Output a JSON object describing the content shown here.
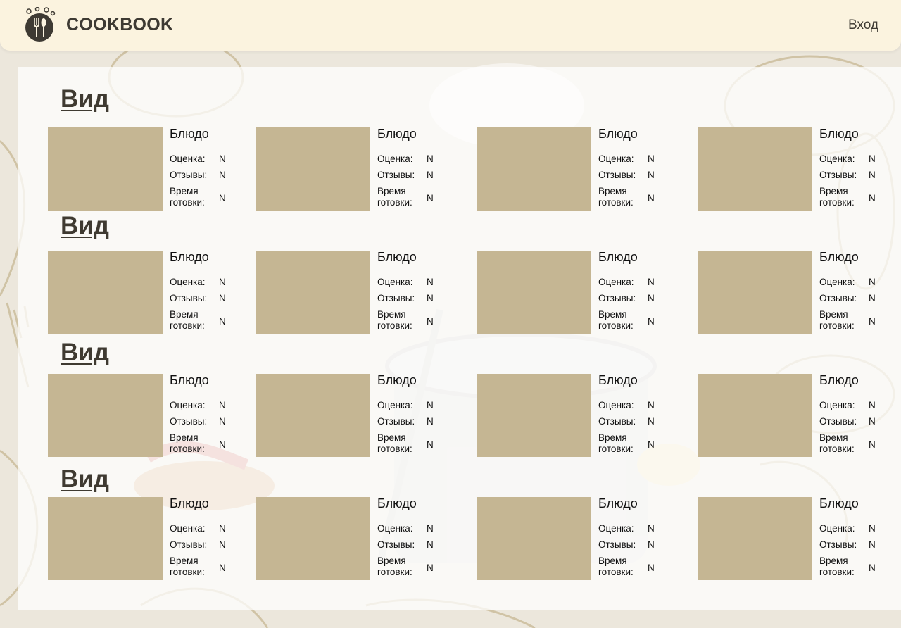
{
  "header": {
    "brand": "COOKBOOK",
    "login_label": "Вход"
  },
  "sections": [
    {
      "title": "Вид",
      "cards": [
        {
          "dish": "Блюдо",
          "rating_label": "Оценка:",
          "rating": "N",
          "reviews_label": "Отзывы:",
          "reviews": "N",
          "time_label_1": "Время",
          "time_label_2": "готовки:",
          "time": "N"
        },
        {
          "dish": "Блюдо",
          "rating_label": "Оценка:",
          "rating": "N",
          "reviews_label": "Отзывы:",
          "reviews": "N",
          "time_label_1": "Время",
          "time_label_2": "готовки:",
          "time": "N"
        },
        {
          "dish": "Блюдо",
          "rating_label": "Оценка:",
          "rating": "N",
          "reviews_label": "Отзывы:",
          "reviews": "N",
          "time_label_1": "Время",
          "time_label_2": "готовки:",
          "time": "N"
        },
        {
          "dish": "Блюдо",
          "rating_label": "Оценка:",
          "rating": "N",
          "reviews_label": "Отзывы:",
          "reviews": "N",
          "time_label_1": "Время",
          "time_label_2": "готовки:",
          "time": "N"
        }
      ]
    },
    {
      "title": "Вид",
      "cards": [
        {
          "dish": "Блюдо",
          "rating_label": "Оценка:",
          "rating": "N",
          "reviews_label": "Отзывы:",
          "reviews": "N",
          "time_label_1": "Время",
          "time_label_2": "готовки:",
          "time": "N"
        },
        {
          "dish": "Блюдо",
          "rating_label": "Оценка:",
          "rating": "N",
          "reviews_label": "Отзывы:",
          "reviews": "N",
          "time_label_1": "Время",
          "time_label_2": "готовки:",
          "time": "N"
        },
        {
          "dish": "Блюдо",
          "rating_label": "Оценка:",
          "rating": "N",
          "reviews_label": "Отзывы:",
          "reviews": "N",
          "time_label_1": "Время",
          "time_label_2": "готовки:",
          "time": "N"
        },
        {
          "dish": "Блюдо",
          "rating_label": "Оценка:",
          "rating": "N",
          "reviews_label": "Отзывы:",
          "reviews": "N",
          "time_label_1": "Время",
          "time_label_2": "готовки:",
          "time": "N"
        }
      ]
    },
    {
      "title": "Вид",
      "cards": [
        {
          "dish": "Блюдо",
          "rating_label": "Оценка:",
          "rating": "N",
          "reviews_label": "Отзывы:",
          "reviews": "N",
          "time_label_1": "Время",
          "time_label_2": "готовки:",
          "time": "N"
        },
        {
          "dish": "Блюдо",
          "rating_label": "Оценка:",
          "rating": "N",
          "reviews_label": "Отзывы:",
          "reviews": "N",
          "time_label_1": "Время",
          "time_label_2": "готовки:",
          "time": "N"
        },
        {
          "dish": "Блюдо",
          "rating_label": "Оценка:",
          "rating": "N",
          "reviews_label": "Отзывы:",
          "reviews": "N",
          "time_label_1": "Время",
          "time_label_2": "готовки:",
          "time": "N"
        },
        {
          "dish": "Блюдо",
          "rating_label": "Оценка:",
          "rating": "N",
          "reviews_label": "Отзывы:",
          "reviews": "N",
          "time_label_1": "Время",
          "time_label_2": "готовки:",
          "time": "N"
        }
      ]
    },
    {
      "title": "Вид",
      "cards": [
        {
          "dish": "Блюдо",
          "rating_label": "Оценка:",
          "rating": "N",
          "reviews_label": "Отзывы:",
          "reviews": "N",
          "time_label_1": "Время",
          "time_label_2": "готовки:",
          "time": "N"
        },
        {
          "dish": "Блюдо",
          "rating_label": "Оценка:",
          "rating": "N",
          "reviews_label": "Отзывы:",
          "reviews": "N",
          "time_label_1": "Время",
          "time_label_2": "готовки:",
          "time": "N"
        },
        {
          "dish": "Блюдо",
          "rating_label": "Оценка:",
          "rating": "N",
          "reviews_label": "Отзывы:",
          "reviews": "N",
          "time_label_1": "Время",
          "time_label_2": "готовки:",
          "time": "N"
        },
        {
          "dish": "Блюдо",
          "rating_label": "Оценка:",
          "rating": "N",
          "reviews_label": "Отзывы:",
          "reviews": "N",
          "time_label_1": "Время",
          "time_label_2": "готовки:",
          "time": "N"
        }
      ]
    }
  ],
  "colors": {
    "header_bg": "#fbf3df",
    "thumb_placeholder": "#c5b693",
    "text_dark": "#3e3a33",
    "decor": "#b9a679"
  },
  "icons": {
    "logo": "fork-spoon-plate-icon"
  }
}
